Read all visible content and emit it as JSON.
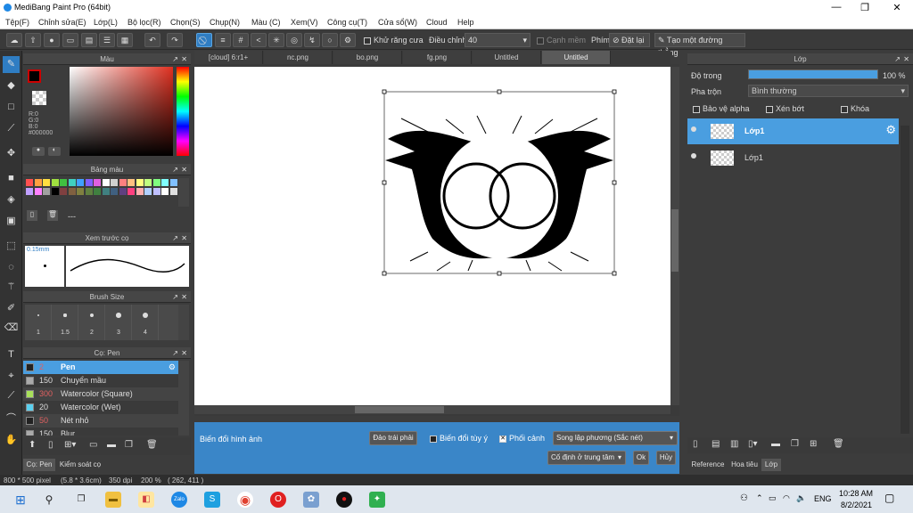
{
  "app": {
    "title": "MediBang Paint Pro (64bit)"
  },
  "window": {
    "minimize": "—",
    "maximize": "❐",
    "close": "✕"
  },
  "menu": [
    "Tệp(F)",
    "Chỉnh sửa(E)",
    "Lớp(L)",
    "Bộ lọc(R)",
    "Chọn(S)",
    "Chụp(N)",
    "Màu (C)",
    "Xem(V)",
    "Công cụ(T)",
    "Cửa sổ(W)",
    "Cloud",
    "Help"
  ],
  "toolbar": {
    "antialias": "Khử răng cưa",
    "adjust_label": "Điều chỉnh",
    "adjust_value": "40",
    "soft_edge": "Cạnh mềm",
    "key_label": "Phím",
    "reset": "Đặt lại",
    "line_btn": "Tạo một đường thẳng"
  },
  "panels": {
    "color": {
      "title": "Màu",
      "r": "R:0",
      "g": "G:0",
      "b": "B:0",
      "hex": "#000000"
    },
    "palette": {
      "title": "Bảng màu",
      "dash": "---"
    },
    "brush_preview": {
      "title": "Xem trước cọ",
      "size": "0.15mm"
    },
    "brush_size": {
      "title": "Brush Size",
      "sizes": [
        "1",
        "1.5",
        "2",
        "3",
        "4"
      ]
    },
    "brushes": {
      "title": "Cọ: Pen",
      "items": [
        {
          "size": "2",
          "name": "Pen",
          "color": "#222222",
          "selected": true
        },
        {
          "size": "150",
          "name": "Chuyển mầu",
          "color": "#aaaaaa",
          "selected": false
        },
        {
          "size": "300",
          "name": "Watercolor (Square)",
          "color": "#a8e05a",
          "selected": false
        },
        {
          "size": "20",
          "name": "Watercolor (Wet)",
          "color": "#5ad0f0",
          "selected": false
        },
        {
          "size": "50",
          "name": "Nét nhỏ",
          "color": "#222222",
          "selected": false
        },
        {
          "size": "150",
          "name": "Blur",
          "color": "#aaaaaa",
          "selected": false
        }
      ]
    },
    "bottom_tabs": [
      "Cọ: Pen",
      "Kiểm soát cọ"
    ]
  },
  "tabs": [
    "[cloud] 6:r1+",
    "nc.png",
    "bo.png",
    "fg.png",
    "Untitled",
    "Untitled"
  ],
  "transform": {
    "label": "Biến đổi hình ảnh",
    "flip": "Đảo trái phải",
    "free": "Biến đổi tùy ý",
    "perspective": "Phối cảnh",
    "interp": "Song lập phương (Sắc nét)",
    "anchor": "Cố định ở trung tâm",
    "ok": "Ok",
    "cancel": "Hủy"
  },
  "layers": {
    "title": "Lớp",
    "opacity_label": "Độ trong",
    "opacity_value": "100 %",
    "opacity": 1.0,
    "blend_label": "Pha trộn",
    "blend_value": "Bình thường",
    "protect_alpha": "Bảo vệ alpha",
    "clip": "Xén bớt",
    "lock": "Khóa",
    "items": [
      {
        "name": "Lớp1",
        "selected": true
      },
      {
        "name": "Lớp1",
        "selected": false
      }
    ],
    "bottom_tabs": [
      "Reference",
      "Hoa tiêu",
      "Lớp"
    ]
  },
  "status": {
    "size": "800 * 500 pixel",
    "cm": "(5.8 * 3.6cm)",
    "dpi": "350 dpi",
    "zoom": "200 %",
    "coords": "( 262, 411 )"
  },
  "taskbar": {
    "lang": "ENG",
    "time": "10:28 AM",
    "date": "8/2/2021"
  },
  "colors": {
    "accent": "#2f7dc3",
    "panel": "#3c3c3c",
    "palette": [
      "#ff5050",
      "#ffa040",
      "#ffe040",
      "#a0e040",
      "#40c040",
      "#40d0c0",
      "#40a0ff",
      "#8060ff",
      "#e060e0",
      "#ffffff",
      "#d0d0d0",
      "#ff8080",
      "#ffc080",
      "#ffff80",
      "#c0ff80",
      "#80ff80",
      "#80ffff",
      "#80c0ff",
      "#c0a0ff",
      "#ff80ff",
      "#a0a0a0",
      "#000000",
      "#804040",
      "#806040",
      "#808040",
      "#608040",
      "#408040",
      "#408080",
      "#406080",
      "#604080",
      "#ff4080",
      "#ffb0b0",
      "#b0d0ff",
      "#c0c0ff",
      "#ffffff",
      "#e0e0e0"
    ]
  }
}
